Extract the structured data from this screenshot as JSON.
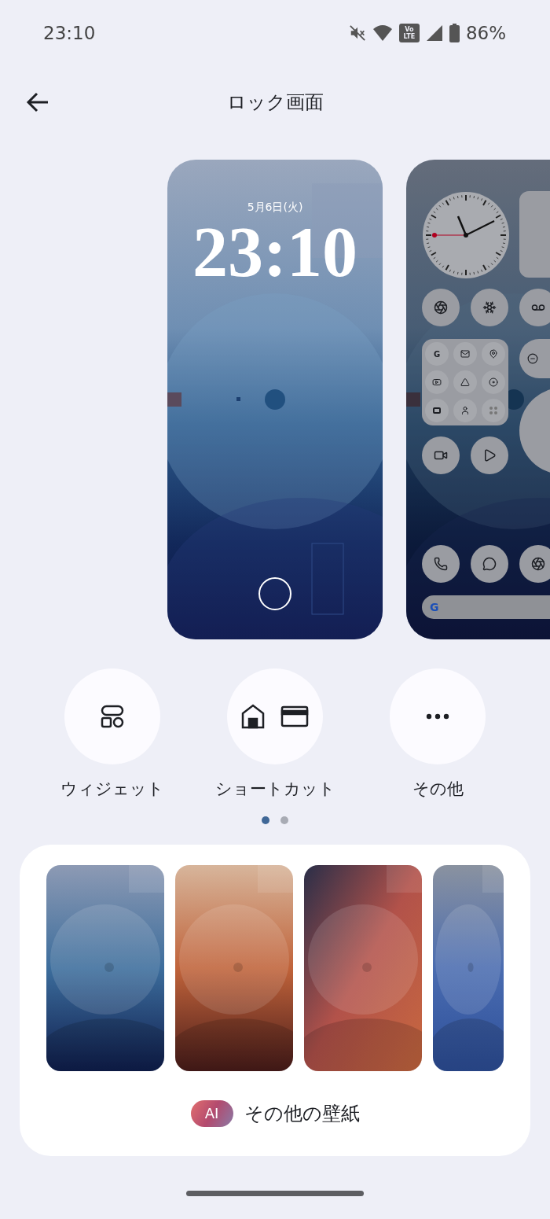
{
  "status_bar": {
    "time": "23:10",
    "network_badge": [
      "Vo",
      "LTE"
    ],
    "battery": "86%"
  },
  "header": {
    "title": "ロック画面"
  },
  "previews": [
    {
      "kind": "lock",
      "date": "5月6日(火)",
      "time": "23:10"
    },
    {
      "kind": "home",
      "folder_letter": "G",
      "search_logo": "G"
    }
  ],
  "actions": [
    {
      "kind": "widget",
      "label": "ウィジェット"
    },
    {
      "kind": "shortcut",
      "label": "ショートカット"
    },
    {
      "kind": "more",
      "label": "その他"
    }
  ],
  "page_dots": [
    {
      "selected": true
    },
    {
      "selected": false
    }
  ],
  "more_wallpapers": {
    "badge": "AI",
    "label": "その他の壁紙"
  }
}
